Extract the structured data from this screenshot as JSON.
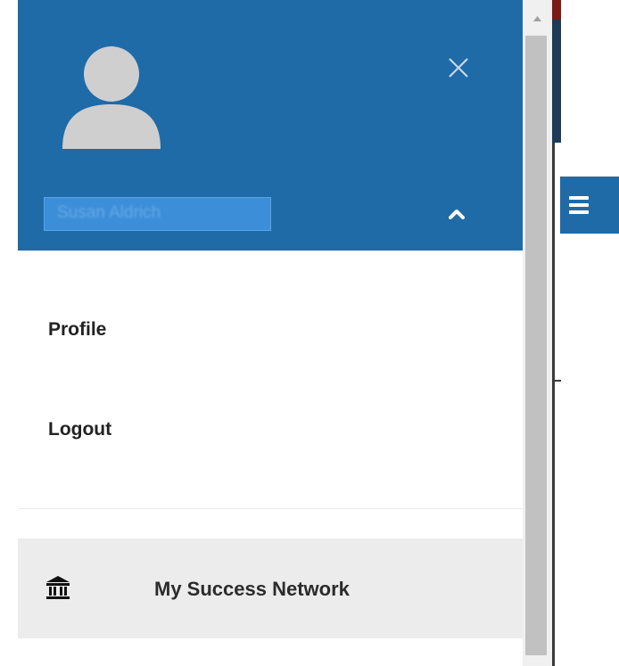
{
  "colors": {
    "header_bg": "#1f6ba8",
    "avatar": "#cfcfcf",
    "network_row_bg": "#ececec",
    "text": "#222222"
  },
  "header": {
    "username": "Susan Aldrich",
    "close_icon": "close-icon",
    "collapse_icon": "chevron-up-icon",
    "avatar_icon": "user-avatar-icon"
  },
  "menu": {
    "items": [
      {
        "label": "Profile"
      },
      {
        "label": "Logout"
      }
    ]
  },
  "network": {
    "label": "My Success Network",
    "icon": "institution-icon"
  },
  "page": {
    "menu_icon": "hamburger-icon"
  }
}
